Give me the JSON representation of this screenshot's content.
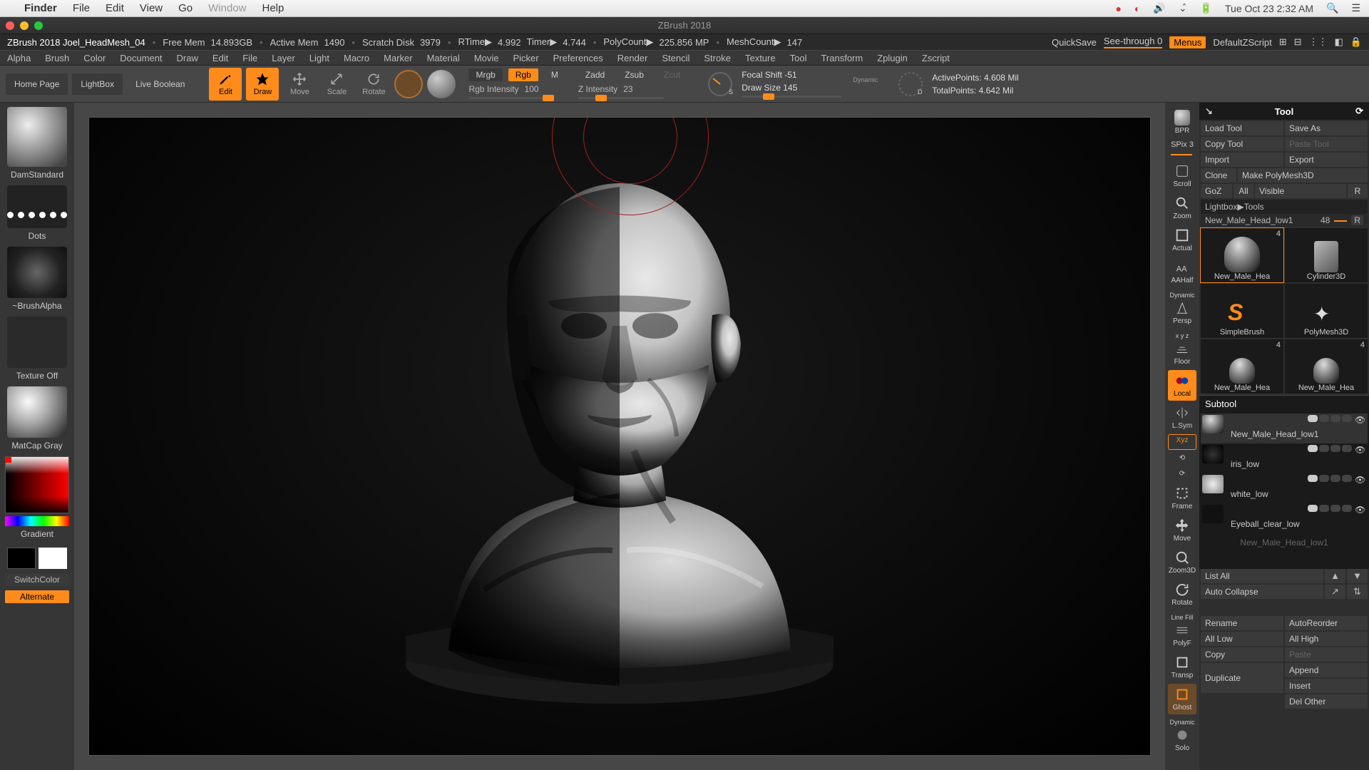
{
  "mac": {
    "app": "Finder",
    "menus": [
      "File",
      "Edit",
      "View",
      "Go",
      "Window",
      "Help"
    ],
    "clock": "Tue Oct 23  2:32 AM"
  },
  "app_title": "ZBrush 2018",
  "status": {
    "doc": "ZBrush 2018 Joel_HeadMesh_04",
    "freemem_label": "Free Mem",
    "freemem": "14.893GB",
    "activemem_label": "Active Mem",
    "activemem": "1490",
    "scratch_label": "Scratch Disk",
    "scratch": "3979",
    "rtime_label": "RTime▶",
    "rtime": "4.992",
    "timer_label": "Timer▶",
    "timer": "4.744",
    "poly_label": "PolyCount▶",
    "poly": "225.856 MP",
    "meshcount_label": "MeshCount▶",
    "meshcount": "147",
    "quicksave": "QuickSave",
    "seethrough": "See-through  0",
    "menus_btn": "Menus",
    "script": "DefaultZScript"
  },
  "mainmenu": [
    "Alpha",
    "Brush",
    "Color",
    "Document",
    "Draw",
    "Edit",
    "File",
    "Layer",
    "Light",
    "Macro",
    "Marker",
    "Material",
    "Movie",
    "Picker",
    "Preferences",
    "Render",
    "Stencil",
    "Stroke",
    "Texture",
    "Tool",
    "Transform",
    "Zplugin",
    "Zscript"
  ],
  "toolbar": {
    "home": "Home Page",
    "lightbox": "LightBox",
    "liveboolean": "Live Boolean",
    "modes": {
      "edit": "Edit",
      "draw": "Draw",
      "move": "Move",
      "scale": "Scale",
      "rotate": "Rotate"
    },
    "mrgb": "Mrgb",
    "rgb": "Rgb",
    "m": "M",
    "rgbint_label": "Rgb Intensity",
    "rgbint": "100",
    "zadd": "Zadd",
    "zsub": "Zsub",
    "zcut": "Zcut",
    "zint_label": "Z Intensity",
    "zint": "23",
    "focal_label": "Focal Shift",
    "focal": "-51",
    "drawsize_label": "Draw Size",
    "drawsize": "145",
    "dynamic": "Dynamic",
    "active_label": "ActivePoints:",
    "active": "4.608 Mil",
    "total_label": "TotalPoints:",
    "total": "4.642 Mil"
  },
  "left": {
    "brush": "DamStandard",
    "stroke": "Dots",
    "alpha": "~BrushAlpha",
    "texture": "Texture Off",
    "material": "MatCap Gray",
    "gradient": "Gradient",
    "switch": "SwitchColor",
    "alternate": "Alternate"
  },
  "view_btns": {
    "bpr": "BPR",
    "spix": "SPix 3",
    "scroll": "Scroll",
    "zoom": "Zoom",
    "actual": "Actual",
    "aahalf": "AAHalf",
    "persp": "Persp",
    "persp_top": "Dynamic",
    "floor": "Floor",
    "floor_top": "x y z",
    "local": "Local",
    "lsym": "L.Sym",
    "xyz": "Xyz",
    "frame": "Frame",
    "move": "Move",
    "zoom3d": "Zoom3D",
    "rotate": "Rotate",
    "linefill": "Line Fill",
    "polyf": "PolyF",
    "transp": "Transp",
    "ghost": "Ghost",
    "dynamic": "Dynamic",
    "solo": "Solo"
  },
  "right": {
    "title": "Tool",
    "btns": {
      "load": "Load Tool",
      "saveas": "Save As",
      "copy": "Copy Tool",
      "paste": "Paste Tool",
      "import": "Import",
      "export": "Export",
      "clone": "Clone",
      "makepoly": "Make PolyMesh3D",
      "goz": "GoZ",
      "all": "All",
      "visible": "Visible",
      "r": "R"
    },
    "lightbox": "Lightbox▶Tools",
    "toolname": "New_Male_Head_low1",
    "toolnum": "48",
    "thumbs": [
      {
        "name": "New_Male_Hea",
        "num": "4"
      },
      {
        "name": "Cylinder3D",
        "num": ""
      },
      {
        "name": "SimpleBrush",
        "num": ""
      },
      {
        "name": "PolyMesh3D",
        "num": ""
      },
      {
        "name": "New_Male_Hea",
        "num": "4"
      },
      {
        "name": "New_Male_Hea",
        "num": "4"
      }
    ],
    "subtool_title": "Subtool",
    "subtools": [
      {
        "name": "New_Male_Head_low1",
        "active": true
      },
      {
        "name": "iris_low"
      },
      {
        "name": "white_low"
      },
      {
        "name": "Eyeball_clear_low"
      },
      {
        "name": "New_Male_Head_low1",
        "dim": true
      }
    ],
    "listall": "List All",
    "autocollapse": "Auto Collapse",
    "bottom": {
      "rename": "Rename",
      "autoreorder": "AutoReorder",
      "alllow": "All Low",
      "allhigh": "All High",
      "copy": "Copy",
      "paste": "Paste",
      "duplicate": "Duplicate",
      "append": "Append",
      "insert": "Insert",
      "delother": "Del Other"
    }
  }
}
